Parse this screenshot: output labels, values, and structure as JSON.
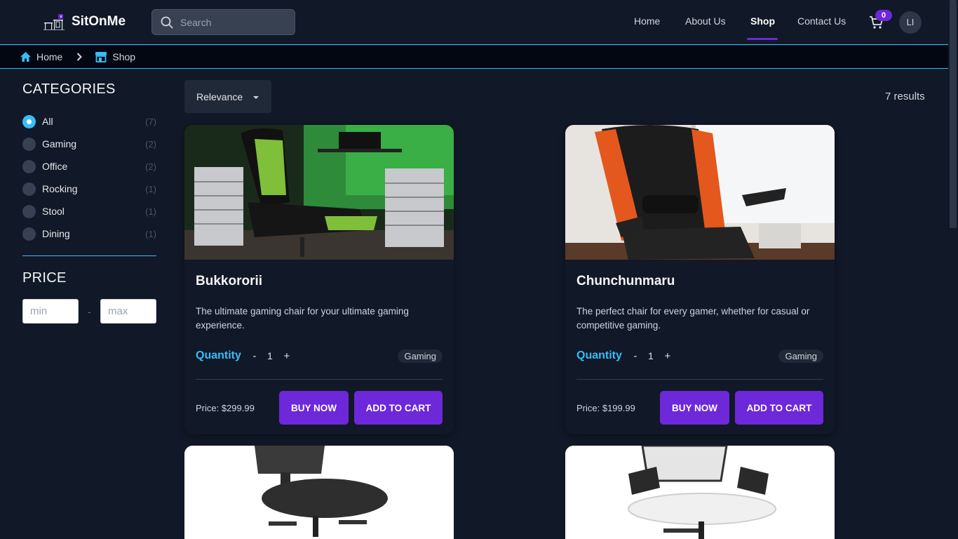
{
  "header": {
    "brand": "SitOnMe",
    "search_placeholder": "Search",
    "nav": [
      {
        "label": "Home"
      },
      {
        "label": "About Us"
      },
      {
        "label": "Shop"
      },
      {
        "label": "Contact Us"
      }
    ],
    "active_nav": "Shop",
    "cart_count": "0",
    "avatar_initials": "LI"
  },
  "breadcrumb": {
    "items": [
      {
        "label": "Home",
        "icon": "home-icon"
      },
      {
        "label": "Shop",
        "icon": "store-icon"
      }
    ]
  },
  "sidebar": {
    "categories_title": "CATEGORIES",
    "categories": [
      {
        "label": "All",
        "count": "(7)",
        "selected": true
      },
      {
        "label": "Gaming",
        "count": "(2)",
        "selected": false
      },
      {
        "label": "Office",
        "count": "(2)",
        "selected": false
      },
      {
        "label": "Rocking",
        "count": "(1)",
        "selected": false
      },
      {
        "label": "Stool",
        "count": "(1)",
        "selected": false
      },
      {
        "label": "Dining",
        "count": "(1)",
        "selected": false
      }
    ],
    "price_title": "PRICE",
    "min_placeholder": "min",
    "separator": "-",
    "max_placeholder": "max"
  },
  "toolbar": {
    "sort_value": "Relevance",
    "results": "7 results"
  },
  "products": [
    {
      "name": "Bukkororii",
      "description": "The ultimate gaming chair for your ultimate gaming experience.",
      "quantity_label": "Quantity",
      "quantity": "1",
      "minus": "-",
      "plus": "+",
      "tag": "Gaming",
      "price": "Price: $299.99",
      "buy_label": "BUY NOW",
      "cart_label": "ADD TO CART"
    },
    {
      "name": "Chunchunmaru",
      "description": "The perfect chair for every gamer, whether for casual or competitive gaming.",
      "quantity_label": "Quantity",
      "quantity": "1",
      "minus": "-",
      "plus": "+",
      "tag": "Gaming",
      "price": "Price: $199.99",
      "buy_label": "BUY NOW",
      "cart_label": "ADD TO CART"
    }
  ],
  "colors": {
    "background": "#111827",
    "accent": "#6d28d9",
    "highlight": "#38bdf8"
  }
}
